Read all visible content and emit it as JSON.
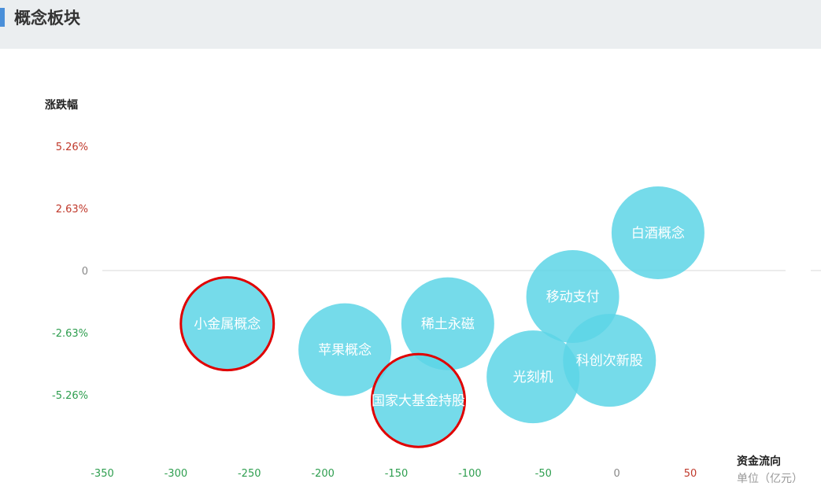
{
  "header": {
    "title": "概念板块"
  },
  "colors": {
    "bubble": "#5dd5e6",
    "highlight_ring": "#e00000",
    "positive": "#c0392b",
    "negative": "#2e9e4f",
    "zero": "#888888"
  },
  "chart_data": {
    "type": "scatter",
    "ylabel": "涨跌幅",
    "xlabel": "资金流向",
    "unit_label": "单位（亿元）",
    "y_ticks": [
      "5.26%",
      "2.63%",
      "0",
      "-2.63%",
      "-5.26%"
    ],
    "x_ticks": [
      "-350",
      "-300",
      "-250",
      "-200",
      "-150",
      "-100",
      "-50",
      "0",
      "50"
    ],
    "xlim": [
      -350,
      50
    ],
    "ylim": [
      -5.26,
      5.26
    ],
    "points": [
      {
        "label": "小金属概念",
        "x": -265,
        "y": -2.25,
        "highlighted": true
      },
      {
        "label": "苹果概念",
        "x": -185,
        "y": -3.35,
        "highlighted": false
      },
      {
        "label": "稀土永磁",
        "x": -115,
        "y": -2.25,
        "highlighted": false
      },
      {
        "label": "国家大基金持股",
        "x": -135,
        "y": -5.5,
        "highlighted": true
      },
      {
        "label": "移动支付",
        "x": -30,
        "y": -1.1,
        "highlighted": false
      },
      {
        "label": "光刻机",
        "x": -57,
        "y": -4.5,
        "highlighted": false
      },
      {
        "label": "科创次新股",
        "x": -5,
        "y": -3.8,
        "highlighted": false
      },
      {
        "label": "白酒概念",
        "x": 28,
        "y": 1.6,
        "highlighted": false
      }
    ]
  }
}
